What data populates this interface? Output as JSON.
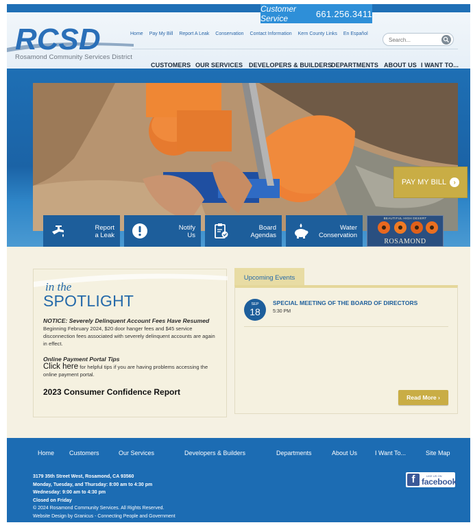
{
  "header": {
    "customer_service_label": "Customer Service",
    "customer_service_phone": "661.256.3411",
    "logo_text": "RCSD",
    "logo_tagline": "Rosamond Community Services District",
    "top_links": [
      "Home",
      "Pay My Bill",
      "Report A Leak",
      "Conservation",
      "Contact Information",
      "Kern County Links",
      "En Español"
    ],
    "search_placeholder": "Search...",
    "main_nav": [
      "CUSTOMERS",
      "OUR SERVICES",
      "DEVELOPERS & BUILDERS",
      "DEPARTMENTS",
      "ABOUT US",
      "I WANT TO..."
    ]
  },
  "hero": {
    "pay_bill_label": "PAY MY BILL",
    "tiles": [
      {
        "line1": "Report",
        "line2": "a Leak",
        "icon": "faucet-icon"
      },
      {
        "line1": "Notify",
        "line2": "Us",
        "icon": "alert-icon"
      },
      {
        "line1": "Board",
        "line2": "Agendas",
        "icon": "clipboard-icon"
      },
      {
        "line1": "Water",
        "line2": "Conservation",
        "icon": "piggy-bank-icon"
      }
    ],
    "rosamond_banner": {
      "top": "BEAUTIFUL HIGH DESERT",
      "word": "ROSAMOND"
    }
  },
  "spotlight": {
    "in_the": "in the",
    "title": "SPOTLIGHT",
    "notice_heading": "NOTICE: Severely Delinquent Account Fees Have Resumed",
    "notice_body": "Beginning February 2024, $20 door hanger fees and $45 service disconnection fees associated with severely delinquent accounts are again in effect.",
    "portal_heading": "Online Payment Portal Tips",
    "click_here": "Click here",
    "portal_body": " for helpful tips if you are having problems accessing the online payment portal.",
    "ccr_link": "2023 Consumer Confidence Report"
  },
  "events": {
    "tab_label": "Upcoming Events",
    "items": [
      {
        "month": "SEP",
        "day": "18",
        "title": "SPECIAL MEETING OF THE BOARD OF DIRECTORS",
        "time": "5:30 PM"
      }
    ],
    "read_more": "Read More ›"
  },
  "footer": {
    "nav": [
      "Home",
      "Customers",
      "Our Services",
      "Developers & Builders",
      "Departments",
      "About Us",
      "I Want To...",
      "Site Map"
    ],
    "address": "3179 35th Street West, Rosamond, CA 93560",
    "hours1": "Monday, Tuesday, and Thursday: 8:00 am to 4:30 pm",
    "hours2": "Wednesday: 9:00 am to 4:30 pm",
    "hours3": "Closed on Friday",
    "copyright": "© 2024 Rosamond Community Services. All Rights Reserved.",
    "credit": "Website Design by Granicus - Connecting People and Government",
    "facebook_like": "LIKE US ON",
    "facebook_word": "facebook"
  },
  "colors": {
    "brand_blue": "#1c6cb3",
    "accent_gold": "#c9ad45",
    "cream": "#f5f1e3"
  }
}
